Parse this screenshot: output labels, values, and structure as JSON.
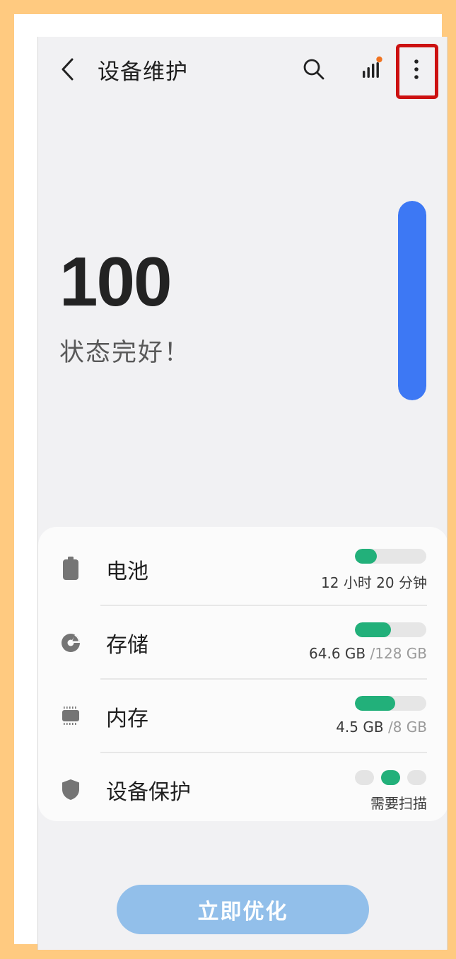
{
  "header": {
    "title": "设备维护",
    "back_icon": "chevron-left-icon",
    "search_icon": "search-icon",
    "signal_icon": "signal-bars-icon",
    "more_icon": "more-vertical-icon",
    "notification_dot_color": "#f07320",
    "highlight_color": "#cc1111"
  },
  "score": {
    "value": "100",
    "status": "状态完好！",
    "level": 1.0,
    "bar_color": "#3d78f4"
  },
  "items": [
    {
      "label": "电池",
      "icon": "battery-icon",
      "value": "12 小时 20 分钟",
      "total": "",
      "fraction": 0.31
    },
    {
      "label": "存储",
      "icon": "storage-pie-icon",
      "value": "64.6 GB ",
      "total": "/128 GB",
      "fraction": 0.505
    },
    {
      "label": "内存",
      "icon": "memory-chip-icon",
      "value": "4.5 GB ",
      "total": "/8 GB",
      "fraction": 0.5625
    },
    {
      "label": "设备保护",
      "icon": "shield-icon",
      "value": "需要扫描",
      "total": "",
      "active_dot": 1
    }
  ],
  "colors": {
    "accent_green": "#22b07a",
    "page_background": "#f1f1f3",
    "outer_background": "#FFCA80"
  },
  "button": {
    "label": "立即优化"
  }
}
